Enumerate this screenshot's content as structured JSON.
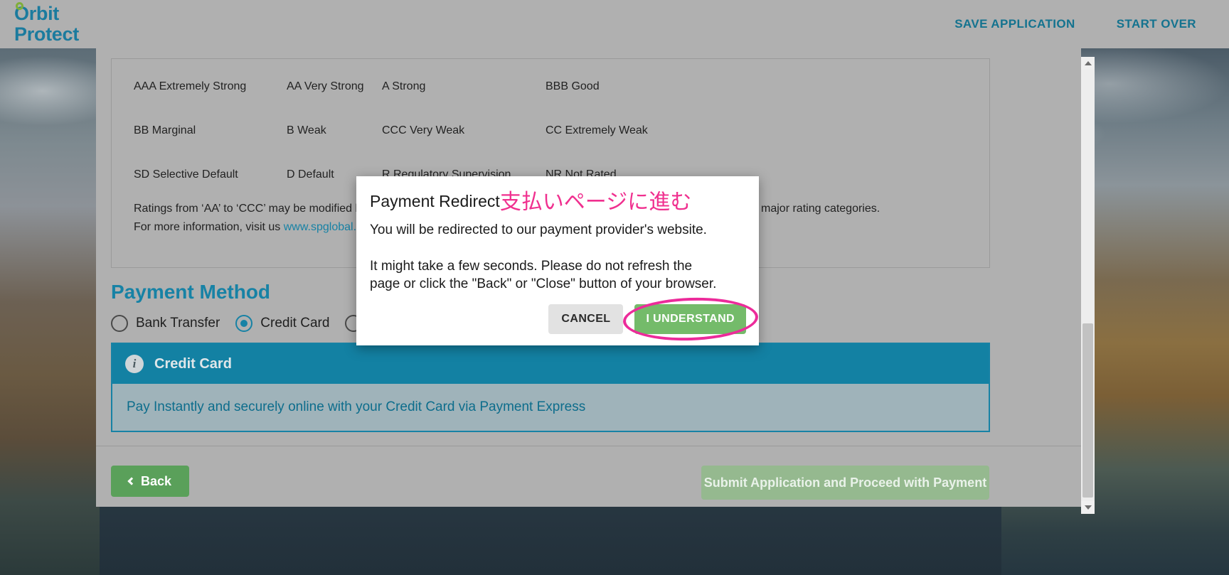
{
  "header": {
    "logo_line1": "Orbit",
    "logo_line2": "Protect",
    "nav": [
      {
        "label": "SAVE APPLICATION"
      },
      {
        "label": "START OVER"
      }
    ]
  },
  "ratings": {
    "rows": [
      [
        "AAA Extremely Strong",
        "AA Very Strong",
        "A Strong",
        "BBB Good"
      ],
      [
        "BB Marginal",
        "B Weak",
        "CCC Very Weak",
        "CC Extremely Weak"
      ],
      [
        "SD Selective Default",
        "D Default",
        "R Regulatory Supervision",
        "NR Not Rated"
      ]
    ],
    "note_line1": "Ratings from ‘AA’ to ‘CCC’ may be modified by the addition of a plus (+) or minus (-) sign to show relative standing within the major rating categories.",
    "note_line2_prefix": "For more information, visit us ",
    "note_link": "www.spglobal.com"
  },
  "payment_method": {
    "title": "Payment Method",
    "options": [
      {
        "label": "Bank Transfer",
        "selected": false
      },
      {
        "label": "Credit Card",
        "selected": true
      },
      {
        "label": "",
        "selected": false
      }
    ],
    "panel": {
      "icon": "info-icon",
      "title": "Credit Card",
      "body": "Pay Instantly and securely online with your Credit Card via Payment Express"
    }
  },
  "footer": {
    "back_label": "Back",
    "submit_label": "Submit Application and Proceed with Payment"
  },
  "modal": {
    "title": "Payment Redirect",
    "title_annotation": "支払いページに進む",
    "line1": "You will be redirected to our payment provider's website.",
    "line2": "It might take a few seconds. Please do not refresh the page or click the \"Back\" or \"Close\" button of your browser.",
    "cancel_label": "CANCEL",
    "understand_label": "I UNDERSTAND"
  },
  "scrollbar": {
    "up_icon": "triangle-up-icon",
    "down_icon": "triangle-down-icon"
  },
  "colors": {
    "brand_teal": "#1782a5",
    "header_grey": "#b0b0b0",
    "green_button": "#5aa05a",
    "green_confirm": "#74bb6a",
    "highlight_pink": "#ec2b9a"
  }
}
